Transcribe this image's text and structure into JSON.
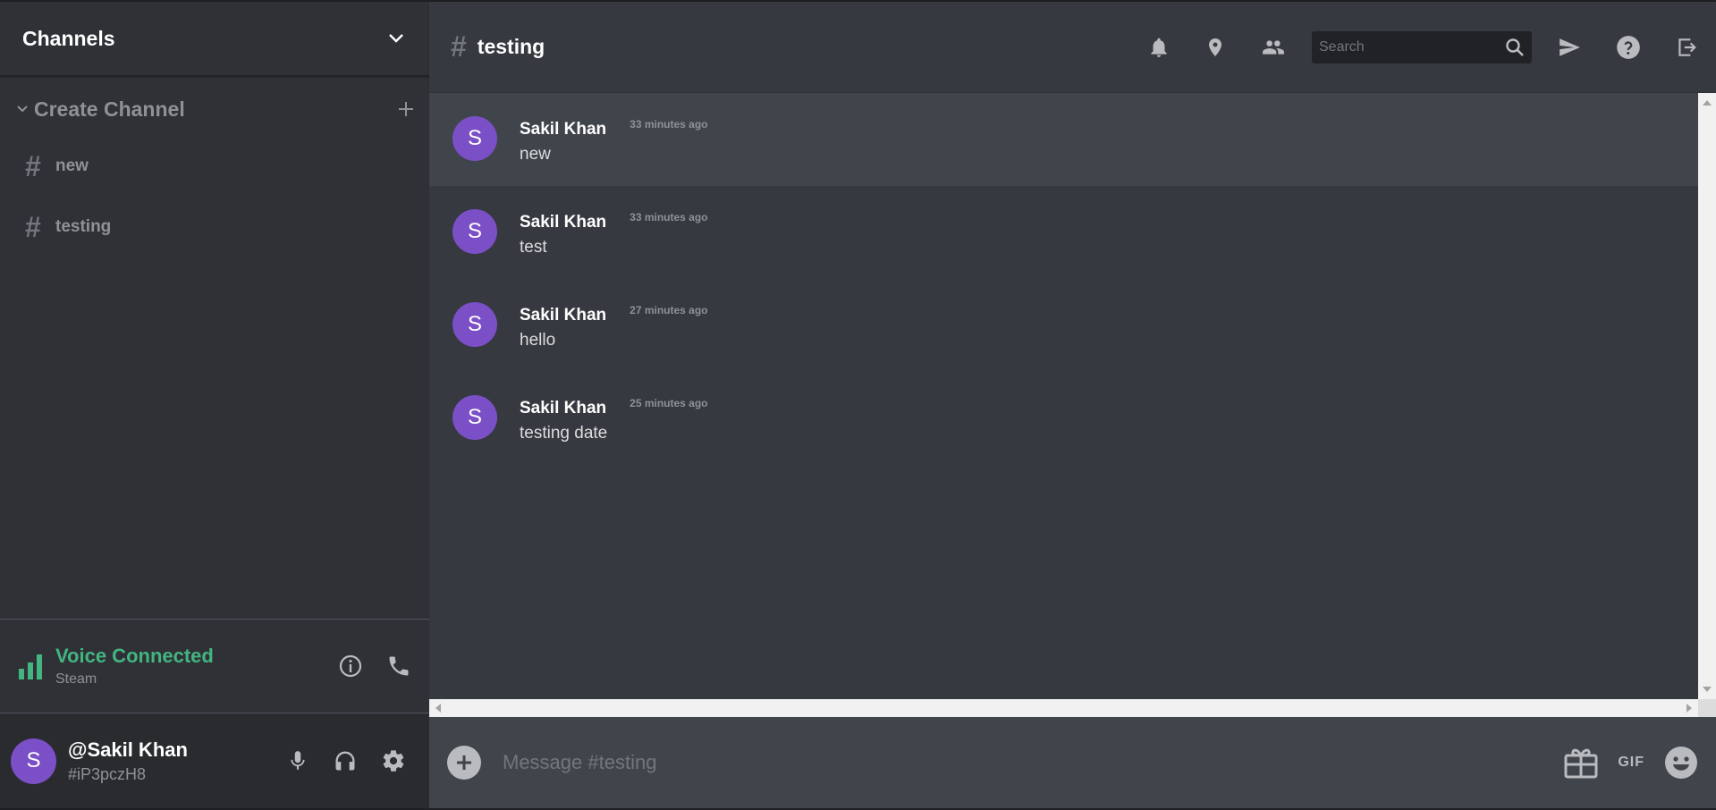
{
  "sidebar": {
    "title": "Channels",
    "category": "Create Channel",
    "channels": [
      {
        "hash": "#",
        "name": "new"
      },
      {
        "hash": "#",
        "name": "testing"
      }
    ],
    "voice": {
      "status": "Voice Connected",
      "server": "Steam"
    },
    "user": {
      "avatar_letter": "S",
      "name": "@Sakil Khan",
      "tag": "#iP3pczH8"
    }
  },
  "header": {
    "hash": "#",
    "channel_name": "testing",
    "search_placeholder": "Search"
  },
  "messages": [
    {
      "avatar_letter": "S",
      "author": "Sakil Khan",
      "time": "33 minutes ago",
      "text": "new"
    },
    {
      "avatar_letter": "S",
      "author": "Sakil Khan",
      "time": "33 minutes ago",
      "text": "test"
    },
    {
      "avatar_letter": "S",
      "author": "Sakil Khan",
      "time": "27 minutes ago",
      "text": "hello"
    },
    {
      "avatar_letter": "S",
      "author": "Sakil Khan",
      "time": "25 minutes ago",
      "text": "testing date"
    }
  ],
  "composer": {
    "placeholder": "Message #testing",
    "gif_label": "GIF"
  },
  "colors": {
    "accent_purple": "#7b4fc6",
    "voice_green": "#43b581",
    "background": "#36393f",
    "sidebar": "#2f3136"
  },
  "icons": [
    "chevron-down-icon",
    "plus-icon",
    "signal-icon",
    "info-icon",
    "phone-icon",
    "mic-icon",
    "headphones-icon",
    "gear-icon",
    "bell-icon",
    "pin-icon",
    "members-icon",
    "search-icon",
    "send-icon",
    "help-icon",
    "logout-icon",
    "gift-icon",
    "emoji-icon"
  ]
}
